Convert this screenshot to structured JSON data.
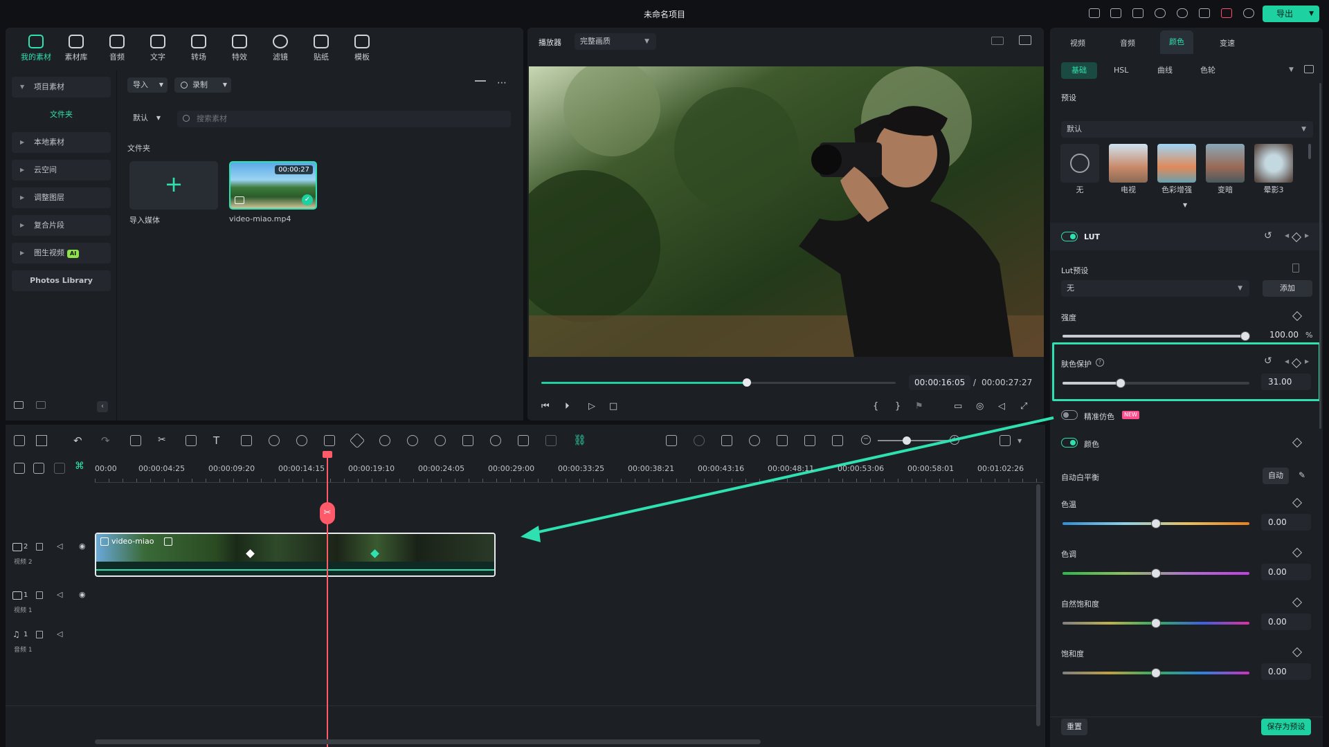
{
  "window": {
    "title": "未命名项目",
    "export_label": "导出"
  },
  "media_tabs": [
    {
      "label": "我的素材",
      "icon": "media-icon",
      "active": true
    },
    {
      "label": "素材库",
      "icon": "library-icon"
    },
    {
      "label": "音频",
      "icon": "music-icon"
    },
    {
      "label": "文字",
      "icon": "text-icon"
    },
    {
      "label": "转场",
      "icon": "transition-icon"
    },
    {
      "label": "特效",
      "icon": "effects-icon"
    },
    {
      "label": "滤镜",
      "icon": "filter-icon"
    },
    {
      "label": "贴纸",
      "icon": "sticker-icon"
    },
    {
      "label": "模板",
      "icon": "template-icon"
    }
  ],
  "sidebar": {
    "project_media": "项目素材",
    "folder": "文件夹",
    "items": [
      "本地素材",
      "云空间",
      "调整图层",
      "复合片段",
      "图生视频"
    ],
    "ai_badge": "AI",
    "photos": "Photos Library"
  },
  "media": {
    "import_label": "导入",
    "record_label": "录制",
    "sort_label": "默认",
    "search_placeholder": "搜索素材",
    "folder_title": "文件夹",
    "import_media_label": "导入媒体",
    "clip_name": "video-miao.mp4",
    "clip_duration": "00:00:27"
  },
  "player": {
    "label": "播放器",
    "quality": "完整画质",
    "current_time": "00:00:16:05",
    "separator": "/",
    "total_time": "00:00:27:27",
    "progress": 0.58
  },
  "right_panel": {
    "tabs": [
      "视频",
      "音频",
      "颜色",
      "变速"
    ],
    "active_tab": "颜色",
    "subtabs": [
      "基础",
      "HSL",
      "曲线",
      "色轮"
    ],
    "preset_title": "预设",
    "preset_dropdown": "默认",
    "presets": [
      "无",
      "电视",
      "色彩增强",
      "变暗",
      "晕影3"
    ],
    "lut_label": "LUT",
    "lut_preset_label": "Lut预设",
    "lut_value": "无",
    "add_label": "添加",
    "strength_label": "强度",
    "strength_value": "100.00",
    "strength_unit": "%",
    "skin_label": "肤色保护",
    "skin_value": "31.00",
    "skin_fraction": 0.31,
    "precise_label": "精准仿色",
    "new_badge": "NEW",
    "color_label": "颜色",
    "awb_label": "自动白平衡",
    "auto_label": "自动",
    "sliders": [
      {
        "label": "色温",
        "value": "0.00"
      },
      {
        "label": "色调",
        "value": "0.00"
      },
      {
        "label": "自然饱和度",
        "value": "0.00"
      },
      {
        "label": "饱和度",
        "value": "0.00"
      }
    ],
    "reset_label": "重置",
    "save_preset_label": "保存为预设"
  },
  "timeline": {
    "ruler": [
      "00:00",
      "00:00:04:25",
      "00:00:09:20",
      "00:00:14:15",
      "00:00:19:10",
      "00:00:24:05",
      "00:00:29:00",
      "00:00:33:25",
      "00:00:38:21",
      "00:00:43:16",
      "00:00:48:11",
      "00:00:53:06",
      "00:00:58:01",
      "00:01:02:26"
    ],
    "tracks": [
      {
        "num": "2",
        "name": "视频 2"
      },
      {
        "num": "1",
        "name": "视频 1"
      },
      {
        "num": "1",
        "name": "音频 1"
      }
    ],
    "clip_label": "video-miao"
  },
  "colors": {
    "accent": "#2fe0b0",
    "playhead": "#ff5a6a"
  }
}
